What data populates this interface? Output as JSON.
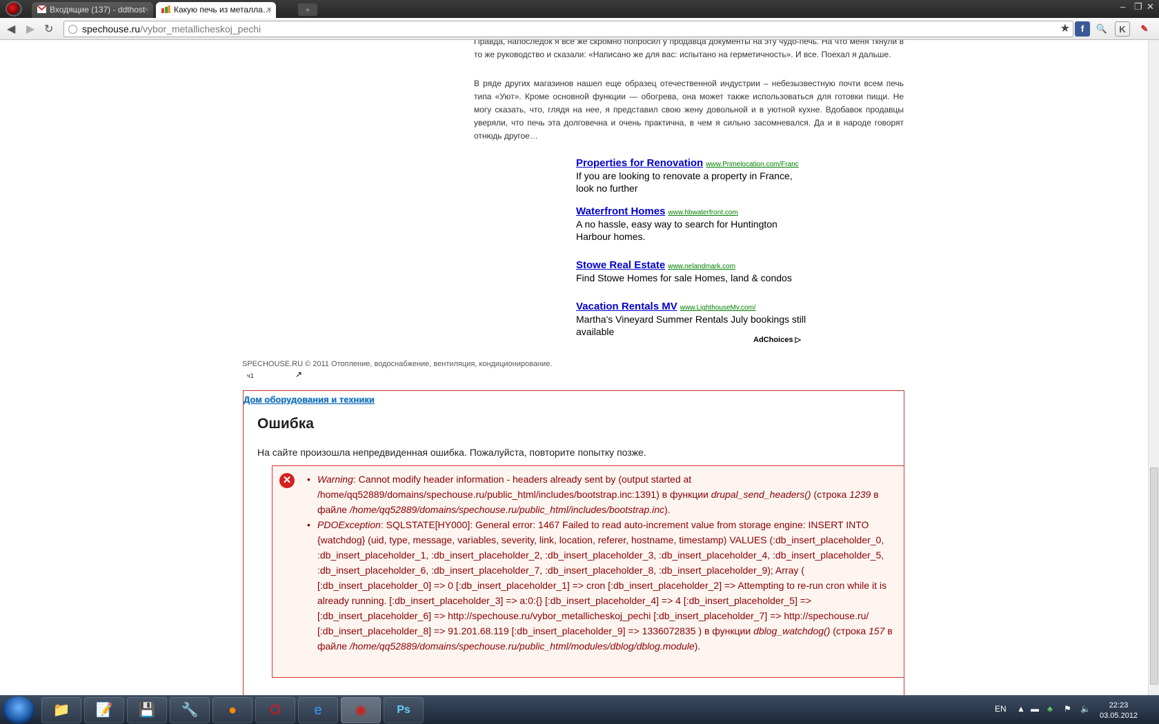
{
  "browser": {
    "tabs": [
      {
        "label": "Входящие (137) - ddthost",
        "active": false,
        "icon": "gmail-icon"
      },
      {
        "label": "Какую печь из металла…",
        "active": true,
        "icon": "site-favicon-icon"
      }
    ],
    "url_host": "spechouse.ru",
    "url_path": "/vybor_metallicheskoj_pechi"
  },
  "article": {
    "paragraph_top": "Правда, напоследок я все же скромно попросил у продавца документы на эту чудо-печь. На что меня ткнули в то же руководство и сказали: «Написано же для вас: испытано на герметичность». И все. Поехал я дальше.",
    "paragraph_2": "В ряде других магазинов нашел еще образец отечественной индустрии – небезызвестную почти всем печь типа «Уют». Кроме основной функции — обогрева, она может также использоваться для готовки пищи. Не могу сказать, что, глядя на нее, я представил свою жену довольной и в уютной кухне. Вдобавок продавцы уверяли, что печь эта долговечна и очень практична, в чем я сильно засомневался. Да и в народе говорят отнюдь другое…"
  },
  "ads": [
    {
      "title": "Properties for Renovation",
      "url": "www.Primelocation.com/Franc",
      "desc": "If you are looking to renovate a property in France, look no further"
    },
    {
      "title": "Waterfront Homes",
      "url": "www.hbwaterfront.com",
      "desc": "A no hassle, easy way to search for Huntington Harbour homes."
    },
    {
      "title": "Stowe Real Estate",
      "url": "www.nelandmark.com",
      "desc": "Find Stowe Homes for sale Homes, land & condos"
    },
    {
      "title": "Vacation Rentals MV",
      "url": "www.LighthouseMv.com/",
      "desc": "Martha's Vineyard Summer Rentals July bookings still available"
    }
  ],
  "adchoices": "AdChoices",
  "footer": "SPECHOUSE.RU © 2011 Отопление, водоснабжение, вентиляция, кондиционирование.",
  "small_mark": "ч1",
  "error_page": {
    "site_link": "Дом оборудования и техники",
    "heading": "Ошибка",
    "subtitle": "На сайте произошла непредвиденная ошибка. Пожалуйста, повторите попытку позже.",
    "errors": [
      {
        "type": "Warning",
        "message": ": Cannot modify header information - headers already sent by (output started at /home/qq52889/domains/spechouse.ru/public_html/includes/bootstrap.inc:1391) в функции ",
        "function": "drupal_send_headers()",
        "line_prefix": " (строка ",
        "line": "1239",
        "file_prefix": " в файле ",
        "file": "/home/qq52889/domains/spechouse.ru/public_html/includes/bootstrap.inc",
        "end": ")."
      },
      {
        "type": "PDOException",
        "message": ": SQLSTATE[HY000]: General error: 1467 Failed to read auto-increment value from storage engine: INSERT INTO {watchdog} (uid, type, message, variables, severity, link, location, referer, hostname, timestamp) VALUES (:db_insert_placeholder_0, :db_insert_placeholder_1, :db_insert_placeholder_2, :db_insert_placeholder_3, :db_insert_placeholder_4, :db_insert_placeholder_5, :db_insert_placeholder_6, :db_insert_placeholder_7, :db_insert_placeholder_8, :db_insert_placeholder_9); Array ( [:db_insert_placeholder_0] => 0 [:db_insert_placeholder_1] => cron [:db_insert_placeholder_2] => Attempting to re-run cron while it is already running. [:db_insert_placeholder_3] => a:0:{} [:db_insert_placeholder_4] => 4 [:db_insert_placeholder_5] => [:db_insert_placeholder_6] => http://spechouse.ru/vybor_metallicheskoj_pechi [:db_insert_placeholder_7] => http://spechouse.ru/ [:db_insert_placeholder_8] => 91.201.68.119 [:db_insert_placeholder_9] => 1336072835 ) в функции ",
        "function": "dblog_watchdog()",
        "line_prefix": " (строка ",
        "line": "157",
        "file_prefix": " в файле ",
        "file": "/home/qq52889/domains/spechouse.ru/public_html/modules/dblog/dblog.module",
        "end": ")."
      }
    ]
  },
  "taskbar": {
    "lang": "EN",
    "time": "22:23",
    "date": "03.05.2012",
    "apps": [
      "explorer-icon",
      "notepad-icon",
      "save-icon",
      "tool-icon",
      "firefox-icon",
      "opera-icon",
      "ie-icon",
      "browser-icon",
      "photoshop-icon"
    ]
  },
  "colors": {
    "link": "#0000cc",
    "ad_url": "#008000",
    "error_text": "#8b0000",
    "error_border": "#cc3333"
  }
}
